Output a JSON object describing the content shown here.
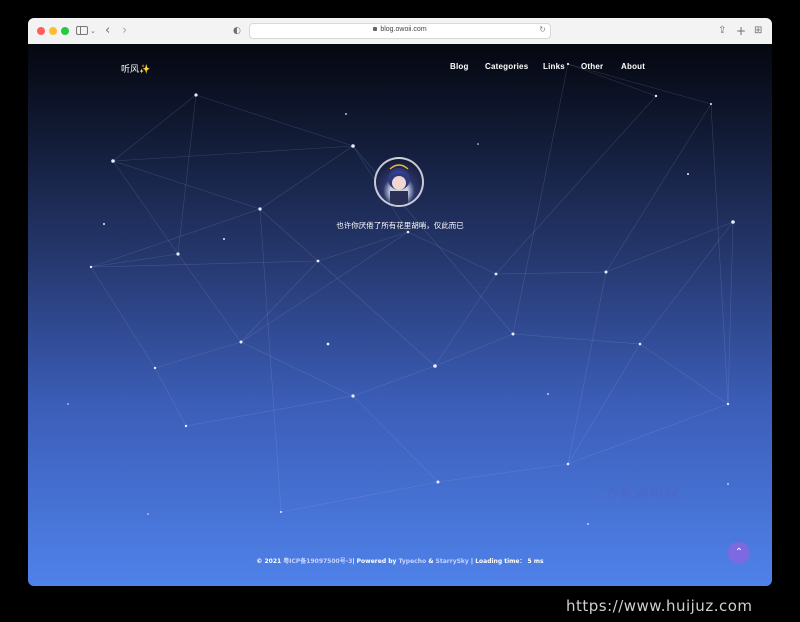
{
  "browser": {
    "url": "blog.owoii.com"
  },
  "site": {
    "brand": "听风✨",
    "nav": [
      {
        "label": "Blog"
      },
      {
        "label": "Categories"
      },
      {
        "label": "Links"
      },
      {
        "label": "Other"
      },
      {
        "label": "About"
      }
    ],
    "tagline": "也许你厌倦了所有花里胡哨，仅此而已",
    "footer": {
      "copyright": "© 2021 ",
      "icp": "粤ICP备19097500号-3",
      "powered_prefix": "| Powered by ",
      "typecho": "Typecho",
      "amp": " & ",
      "theme": "StarrySky",
      "loading": " | Loading time： 5 ms"
    },
    "watermark": "力客源码网"
  },
  "back_to_top_icon": "chevron-up-icon",
  "screen_watermark": "https://www.huijuz.com",
  "colors": {
    "accent": "#7d6ae0",
    "gradient_top": "#05070f",
    "gradient_bottom": "#4f82ea"
  }
}
